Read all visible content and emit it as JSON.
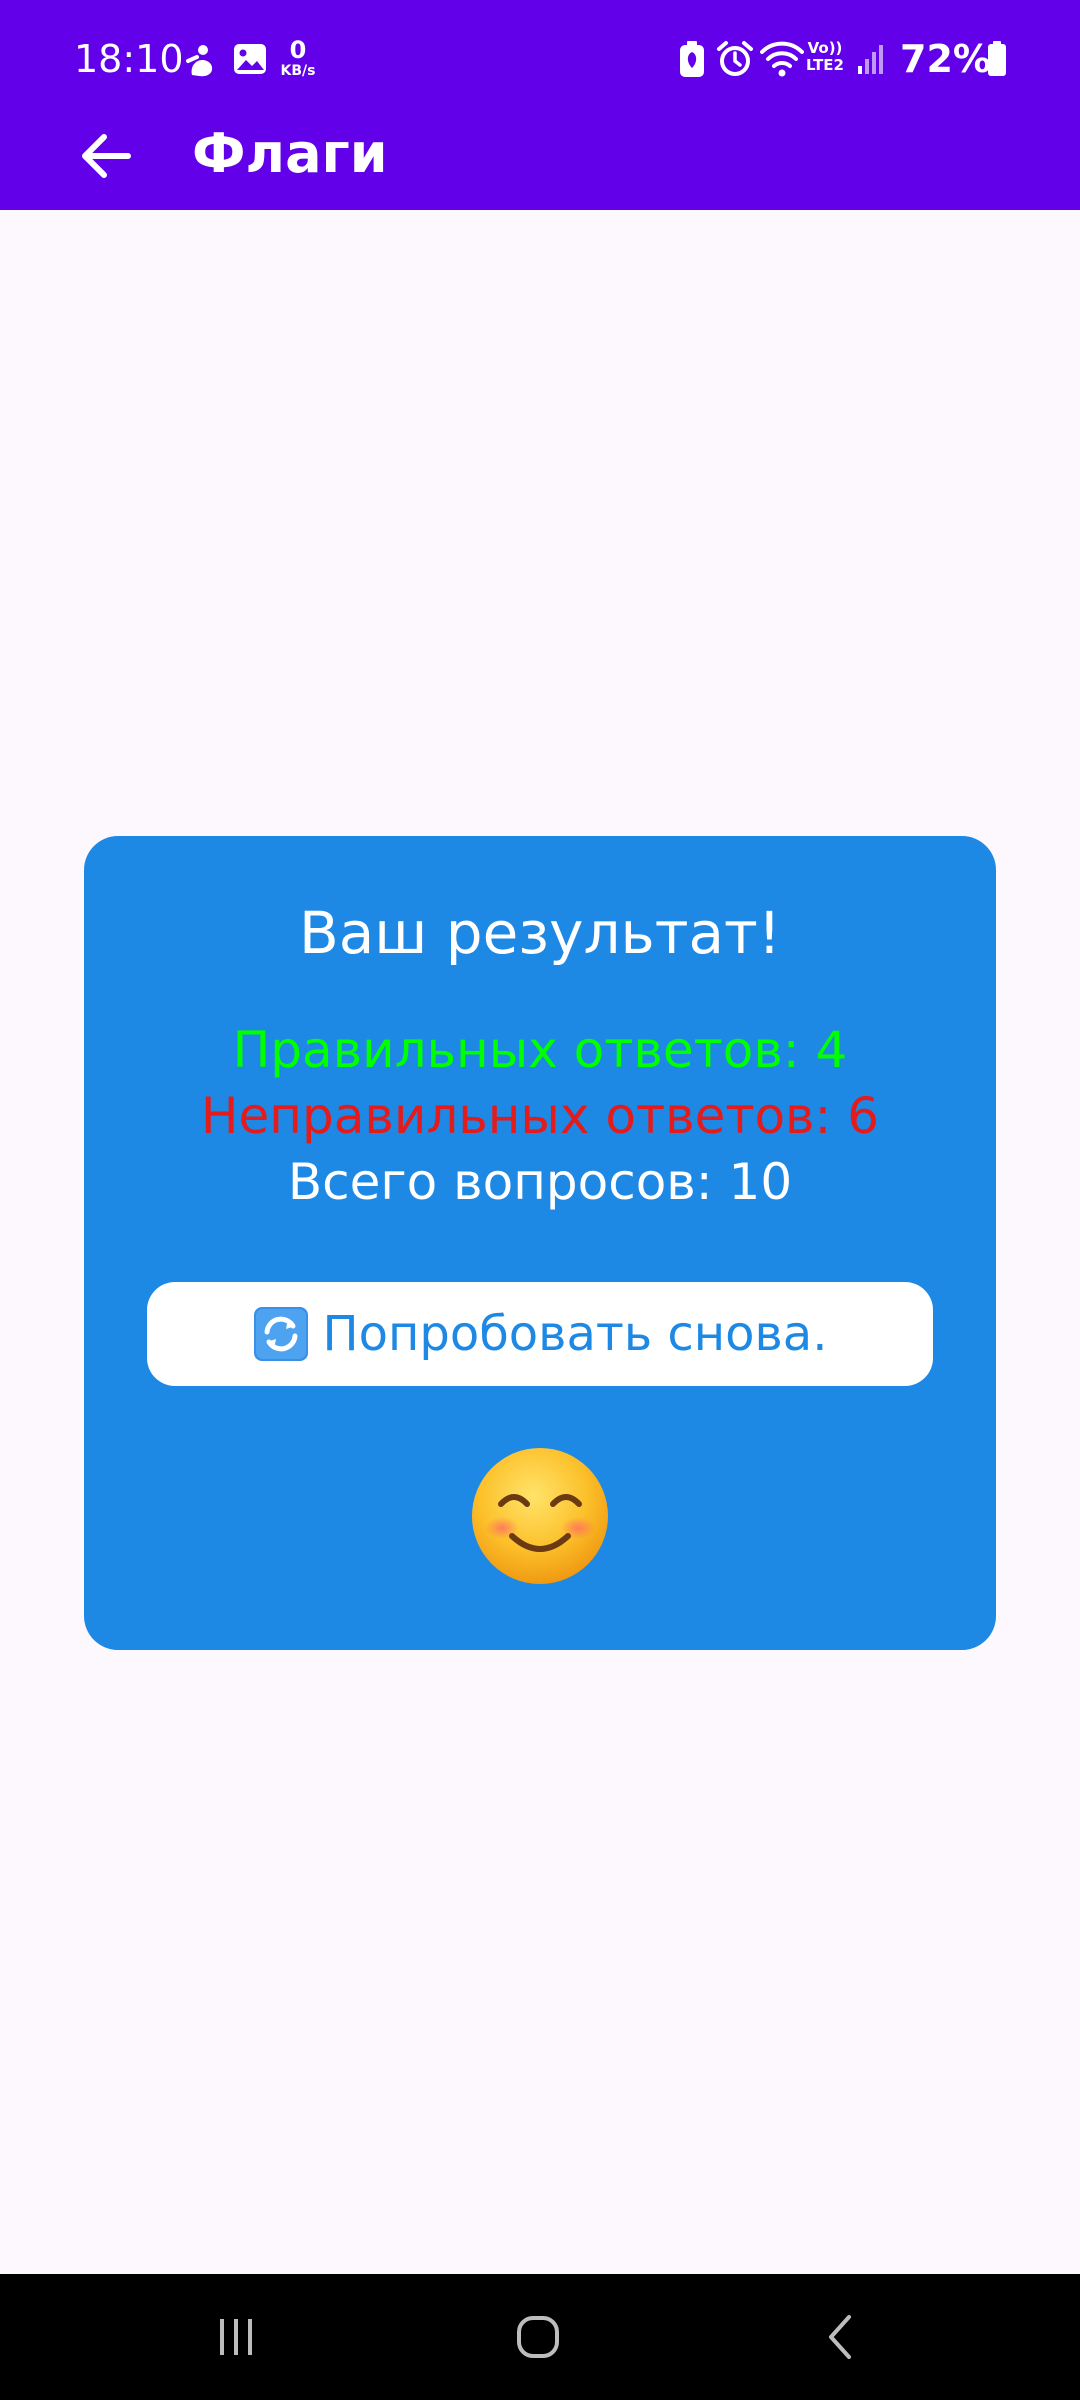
{
  "status_bar": {
    "time": "18:10",
    "net_speed_value": "0",
    "net_speed_unit": "KB/s",
    "volte_line1": "Vo))",
    "volte_line2": "LTE2",
    "battery_percent": "72%",
    "icons": [
      "fitness-icon",
      "gallery-icon",
      "battery-saver-icon",
      "alarm-icon",
      "wifi-icon",
      "signal-icon",
      "battery-icon"
    ]
  },
  "app_bar": {
    "title": "Флаги",
    "back_icon": "arrow-left-icon"
  },
  "result_card": {
    "title": "Ваш результат!",
    "correct_text": "Правильных ответов: 4",
    "wrong_text": "Неправильных ответов: 6",
    "total_text": "Всего вопросов: 10",
    "correct_count": 4,
    "wrong_count": 6,
    "total_count": 10,
    "retry_icon": "refresh-icon",
    "retry_label": "Попробовать снова.",
    "emoji": "smiling-face-icon"
  },
  "nav_bar": {
    "buttons": [
      "recent-apps-icon",
      "home-icon",
      "back-icon"
    ]
  },
  "colors": {
    "primary": "#6200ea",
    "card": "#1e88e5",
    "correct": "#00ff00",
    "wrong": "#e41b1b",
    "background": "#fdf8fd"
  }
}
